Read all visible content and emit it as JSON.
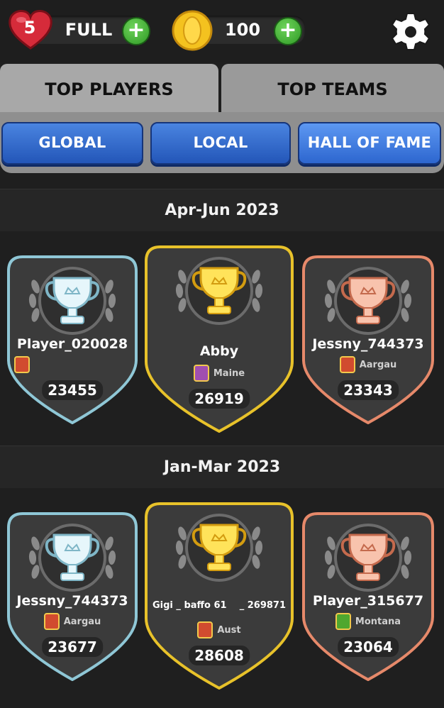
{
  "header": {
    "lives": "5",
    "lives_status": "FULL",
    "coins": "100",
    "plus_symbol": "+"
  },
  "tabs": [
    {
      "label": "TOP PLAYERS",
      "active": true
    },
    {
      "label": "TOP TEAMS",
      "active": false
    }
  ],
  "scopes": [
    {
      "label": "GLOBAL"
    },
    {
      "label": "LOCAL"
    },
    {
      "label": "HALL OF FAME",
      "selected": true
    }
  ],
  "seasons": [
    {
      "title": "Apr-Jun 2023",
      "silver": {
        "name": "Player_020028",
        "region": "",
        "score": "23455"
      },
      "gold": {
        "name": "Abby",
        "region": "Maine",
        "score": "26919"
      },
      "bronze": {
        "name": "Jessny_744373",
        "region": "Aargau",
        "score": "23343"
      }
    },
    {
      "title": "Jan-Mar 2023",
      "silver": {
        "name": "Jessny_744373",
        "region": "Aargau",
        "score": "23677"
      },
      "gold": {
        "name": "Gigi _ baffo 61    _ 269871",
        "region": "Aust",
        "score": "28608"
      },
      "bronze": {
        "name": "Player_315677",
        "region": "Montana",
        "score": "23064"
      }
    }
  ],
  "colors": {
    "gold": "#e8c22a",
    "silver": "#8fc7d6",
    "bronze": "#e6896a",
    "button_blue": "#2f63c8",
    "plus_green": "#3aa52e"
  }
}
